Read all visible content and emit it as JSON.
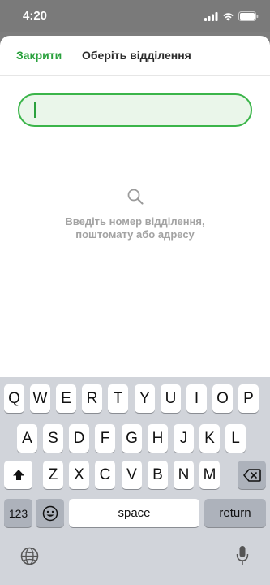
{
  "status_bar": {
    "time": "4:20"
  },
  "header": {
    "close_label": "Закрити",
    "title": "Оберіть відділення"
  },
  "search": {
    "value": "",
    "placeholder": ""
  },
  "empty_state": {
    "line1": "Введіть номер відділення,",
    "line2": "поштомату або адресу"
  },
  "keyboard": {
    "row1": [
      "Q",
      "W",
      "E",
      "R",
      "T",
      "Y",
      "U",
      "I",
      "O",
      "P"
    ],
    "row2": [
      "A",
      "S",
      "D",
      "F",
      "G",
      "H",
      "J",
      "K",
      "L"
    ],
    "row3": [
      "Z",
      "X",
      "C",
      "V",
      "B",
      "N",
      "M"
    ],
    "numbers_label": "123",
    "space_label": "space",
    "return_label": "return"
  },
  "colors": {
    "accent": "#2aa13d",
    "field_bg": "#eaf6ea",
    "keyboard_bg": "#d1d4da"
  }
}
